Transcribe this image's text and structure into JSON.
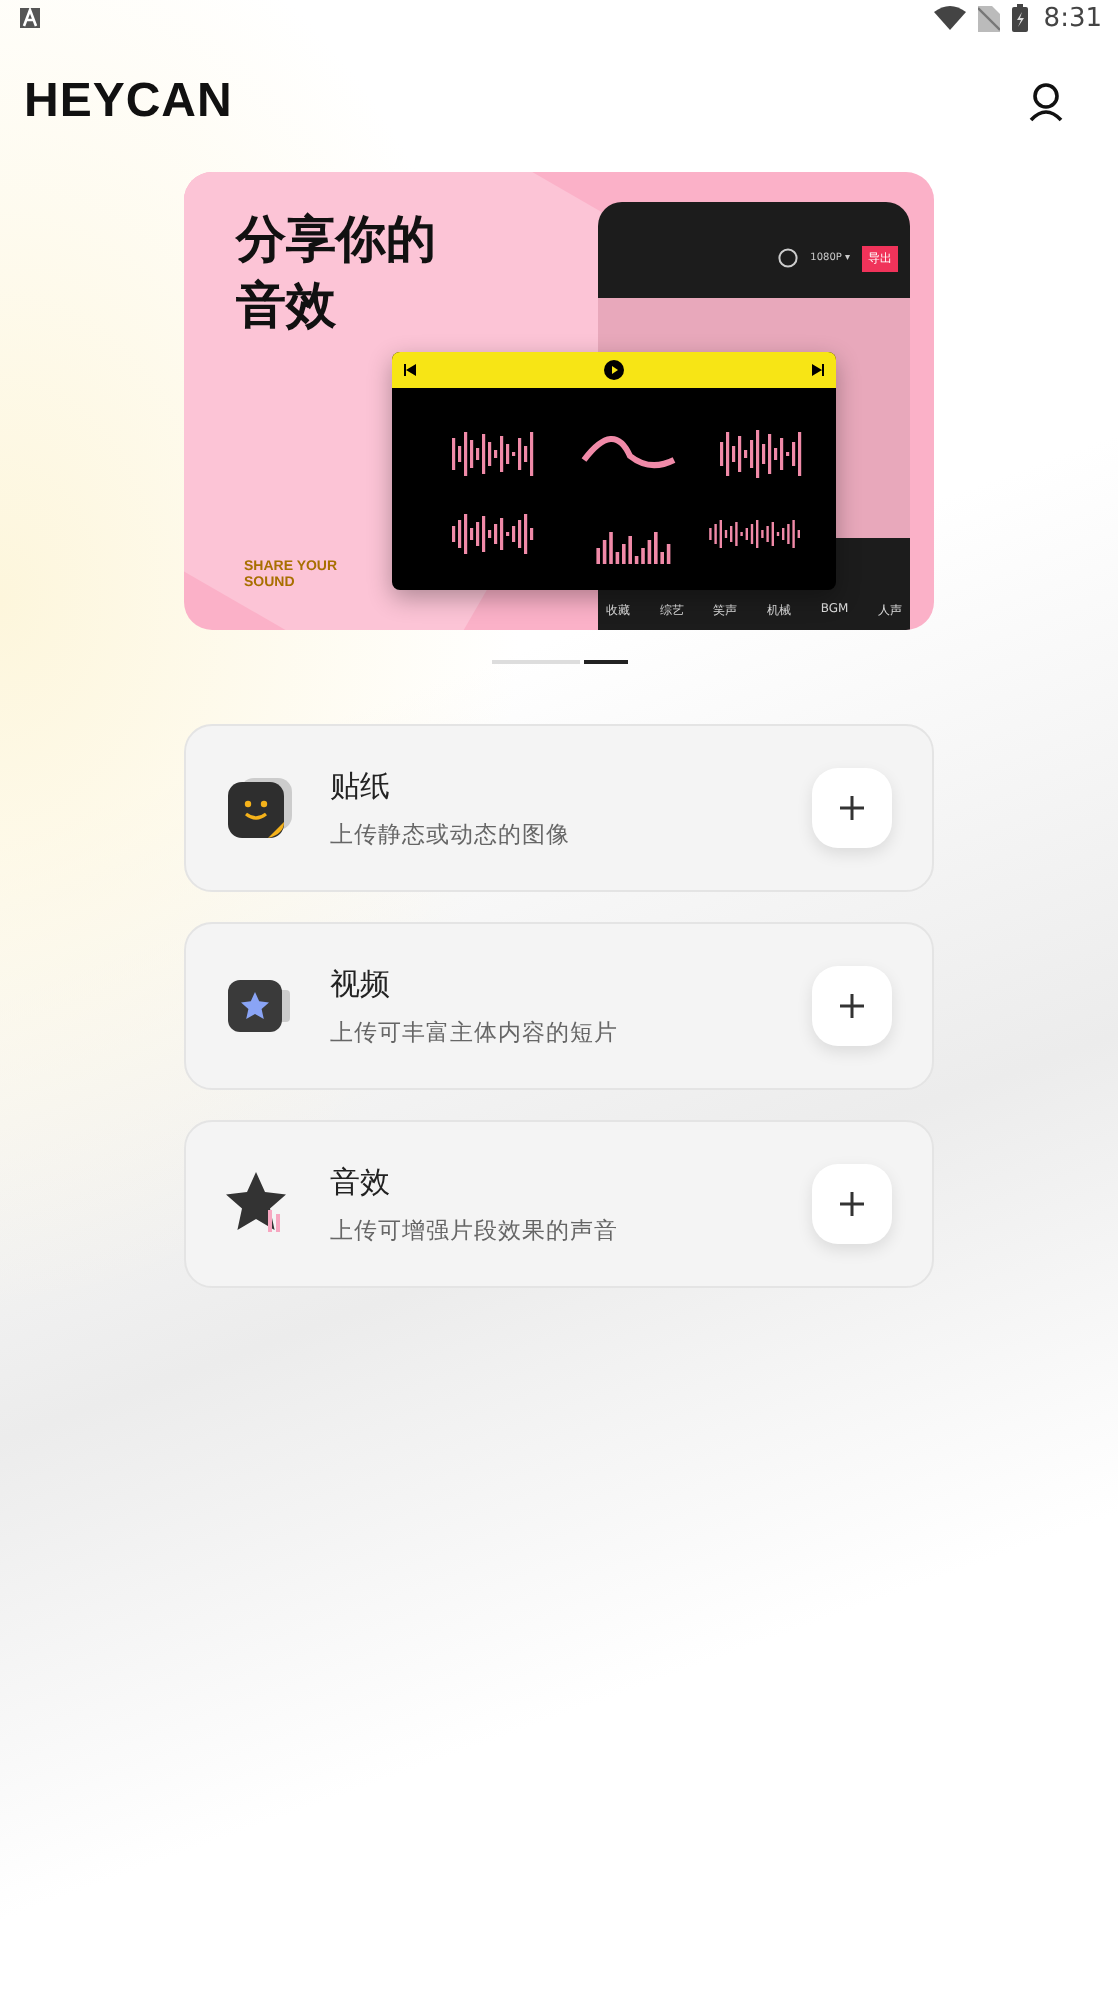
{
  "status_bar": {
    "time": "8:31"
  },
  "header": {
    "logo": "HEYCAN"
  },
  "banner": {
    "headline": [
      "分享你的",
      "音效"
    ],
    "tagline": [
      "SHARE YOUR",
      "SOUND"
    ],
    "phone": {
      "resolution": "1080P ▾",
      "export": "导出",
      "categories": [
        "收藏",
        "综艺",
        "笑声",
        "机械",
        "BGM",
        "人声"
      ]
    }
  },
  "carousel": [
    {
      "selected": false
    },
    {
      "selected": true
    }
  ],
  "items": [
    {
      "kind": "sticker",
      "title": "贴纸",
      "subtitle": "上传静态或动态的图像"
    },
    {
      "kind": "video",
      "title": "视频",
      "subtitle": "上传可丰富主体内容的短片"
    },
    {
      "kind": "sound",
      "title": "音效",
      "subtitle": "上传可增强片段效果的声音"
    }
  ]
}
